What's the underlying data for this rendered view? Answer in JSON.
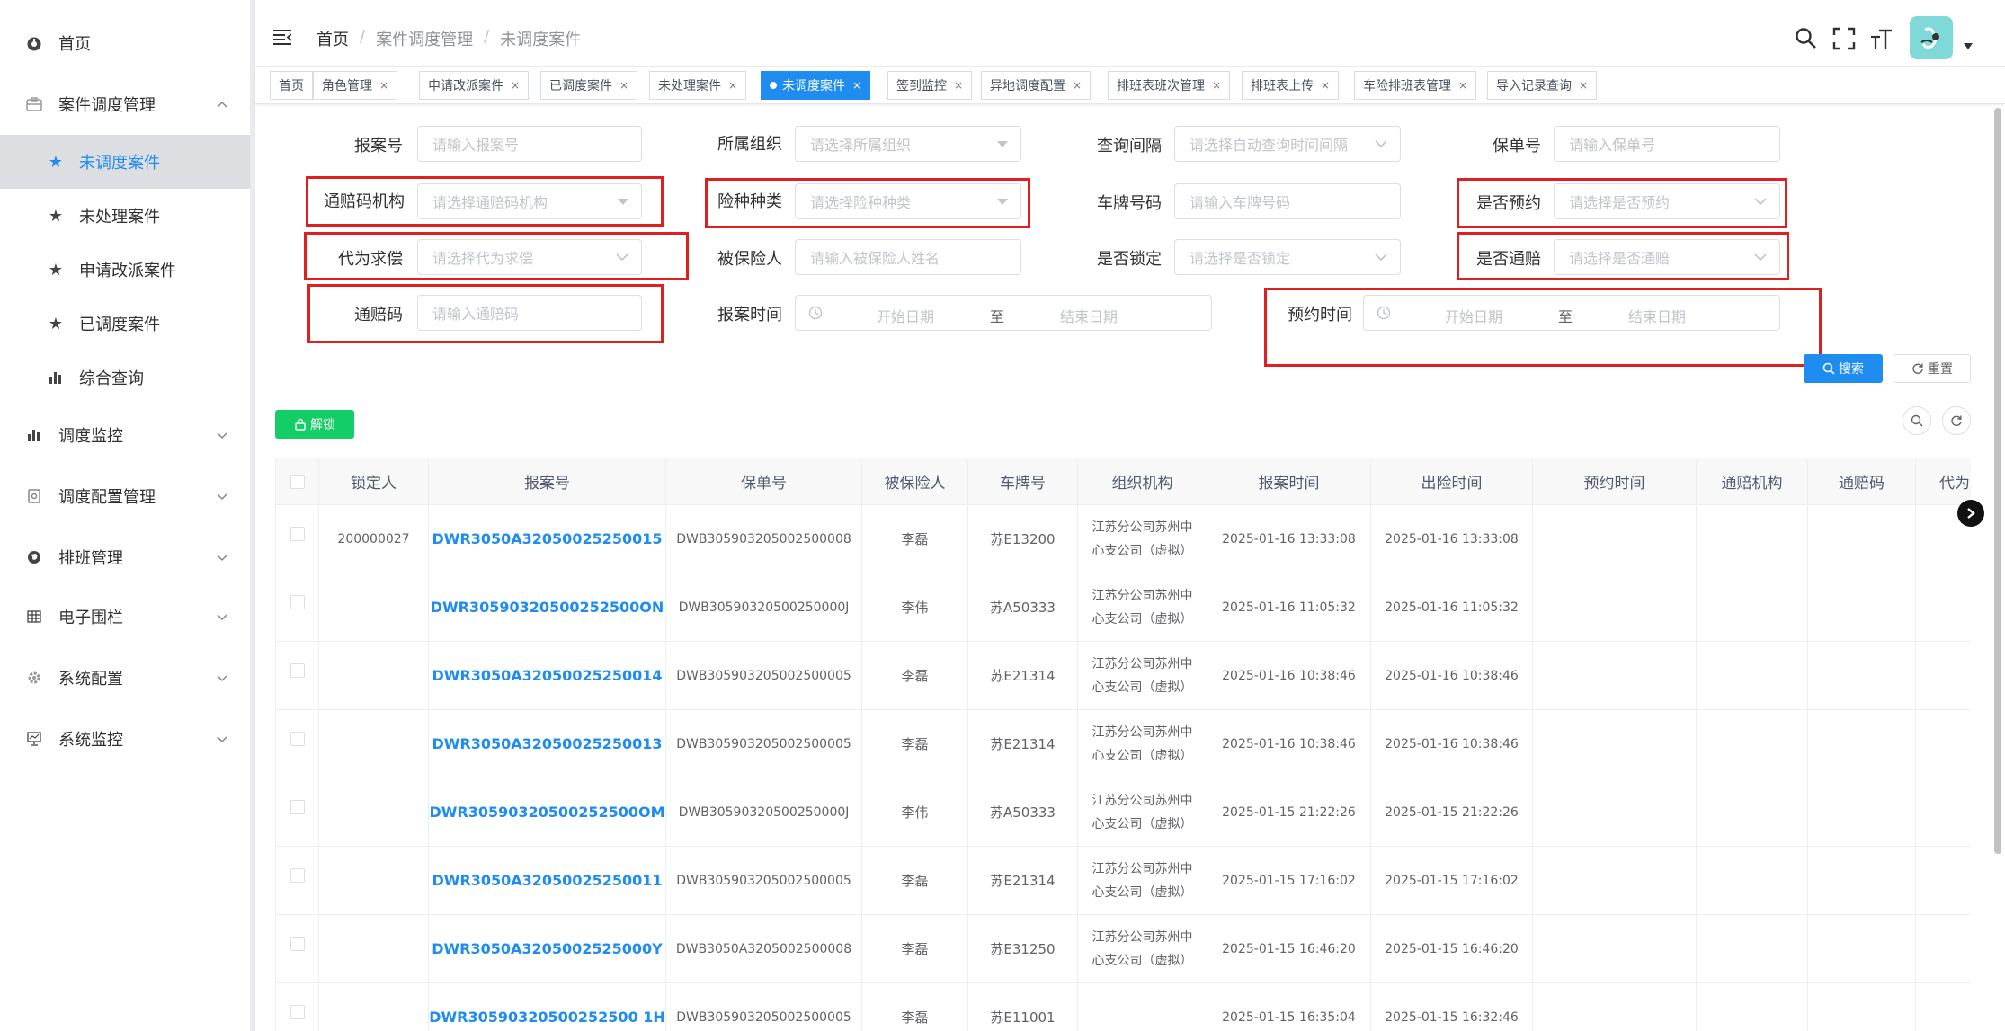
{
  "sidebar": {
    "items": [
      {
        "label": "首页",
        "icon": "dashboard-icon"
      },
      {
        "label": "案件调度管理",
        "icon": "case-icon"
      },
      {
        "label": "未调度案件",
        "icon": "star-icon"
      },
      {
        "label": "未处理案件",
        "icon": "star-icon"
      },
      {
        "label": "申请改派案件",
        "icon": "star-icon"
      },
      {
        "label": "已调度案件",
        "icon": "star-icon"
      },
      {
        "label": "综合查询",
        "icon": "bar-chart-icon"
      },
      {
        "label": "调度监控",
        "icon": "bar-chart-icon"
      },
      {
        "label": "调度配置管理",
        "icon": "config-icon"
      },
      {
        "label": "排班管理",
        "icon": "globe-icon"
      },
      {
        "label": "电子围栏",
        "icon": "grid-icon"
      },
      {
        "label": "系统配置",
        "icon": "gear-icon"
      },
      {
        "label": "系统监控",
        "icon": "monitor-icon"
      }
    ]
  },
  "header": {
    "breadcrumb": [
      "首页",
      "案件调度管理",
      "未调度案件"
    ],
    "separator": "/"
  },
  "tags": [
    {
      "label": "首页",
      "closable": false
    },
    {
      "label": "角色管理",
      "closable": true
    },
    {
      "label": "申请改派案件",
      "closable": true
    },
    {
      "label": "已调度案件",
      "closable": true
    },
    {
      "label": "未处理案件",
      "closable": true
    },
    {
      "label": "未调度案件",
      "closable": true,
      "active": true
    },
    {
      "label": "签到监控",
      "closable": true
    },
    {
      "label": "异地调度配置",
      "closable": true
    },
    {
      "label": "排班表班次管理",
      "closable": true
    },
    {
      "label": "排班表上传",
      "closable": true
    },
    {
      "label": "车险排班表管理",
      "closable": true
    },
    {
      "label": "导入记录查询",
      "closable": true
    }
  ],
  "close_glyph": "×",
  "form": {
    "report_no": {
      "label": "报案号",
      "placeholder": "请输入报案号"
    },
    "org": {
      "label": "所属组织",
      "placeholder": "请选择所属组织"
    },
    "interval": {
      "label": "查询间隔",
      "placeholder": "请选择自动查询时间间隔"
    },
    "policy_no": {
      "label": "保单号",
      "placeholder": "请输入保单号"
    },
    "tongpei_org": {
      "label": "通赔码机构",
      "placeholder": "请选择通赔码机构"
    },
    "insurance_type": {
      "label": "险种种类",
      "placeholder": "请选择险种种类"
    },
    "plate_no": {
      "label": "车牌号码",
      "placeholder": "请输入车牌号码"
    },
    "reserved": {
      "label": "是否预约",
      "placeholder": "请选择是否预约"
    },
    "subrogation": {
      "label": "代为求偿",
      "placeholder": "请选择代为求偿"
    },
    "insured": {
      "label": "被保险人",
      "placeholder": "请输入被保险人姓名"
    },
    "locked": {
      "label": "是否锁定",
      "placeholder": "请选择是否锁定"
    },
    "tongpei": {
      "label": "是否通赔",
      "placeholder": "请选择是否通赔"
    },
    "tongpei_code": {
      "label": "通赔码",
      "placeholder": "请输入通赔码"
    },
    "report_time": {
      "label": "报案时间",
      "start": "开始日期",
      "to": "至",
      "end": "结束日期"
    },
    "reserve_time": {
      "label": "预约时间",
      "start": "开始日期",
      "to": "至",
      "end": "结束日期"
    }
  },
  "buttons": {
    "search": "搜索",
    "reset": "重置",
    "unlock": "解锁"
  },
  "table": {
    "columns": [
      "锁定人",
      "报案号",
      "保单号",
      "被保险人",
      "车牌号",
      "组织机构",
      "报案时间",
      "出险时间",
      "预约时间",
      "通赔机构",
      "通赔码",
      "代为求"
    ],
    "rows": [
      {
        "locker": "200000027",
        "report_no": "DWR3050A32050025250015",
        "policy_no": "DWB305903205002500008",
        "insured": "李磊",
        "plate": "苏E13200",
        "org": "江苏分公司苏州中心支公司（虚拟）",
        "report_time": "2025-01-16 13:33:08",
        "accident_time": "2025-01-16 13:33:08"
      },
      {
        "locker": "",
        "report_no": "DWR30590320500252500ON",
        "policy_no": "DWB30590320500250000J",
        "insured": "李伟",
        "plate": "苏A50333",
        "org": "江苏分公司苏州中心支公司（虚拟）",
        "report_time": "2025-01-16 11:05:32",
        "accident_time": "2025-01-16 11:05:32"
      },
      {
        "locker": "",
        "report_no": "DWR3050A32050025250014",
        "policy_no": "DWB305903205002500005",
        "insured": "李磊",
        "plate": "苏E21314",
        "org": "江苏分公司苏州中心支公司（虚拟）",
        "report_time": "2025-01-16 10:38:46",
        "accident_time": "2025-01-16 10:38:46"
      },
      {
        "locker": "",
        "report_no": "DWR3050A32050025250013",
        "policy_no": "DWB305903205002500005",
        "insured": "李磊",
        "plate": "苏E21314",
        "org": "江苏分公司苏州中心支公司（虚拟）",
        "report_time": "2025-01-16 10:38:46",
        "accident_time": "2025-01-16 10:38:46"
      },
      {
        "locker": "",
        "report_no": "DWR30590320500252500OM",
        "policy_no": "DWB30590320500250000J",
        "insured": "李伟",
        "plate": "苏A50333",
        "org": "江苏分公司苏州中心支公司（虚拟）",
        "report_time": "2025-01-15 21:22:26",
        "accident_time": "2025-01-15 21:22:26"
      },
      {
        "locker": "",
        "report_no": "DWR3050A32050025250011",
        "policy_no": "DWB305903205002500005",
        "insured": "李磊",
        "plate": "苏E21314",
        "org": "江苏分公司苏州中心支公司（虚拟）",
        "report_time": "2025-01-15 17:16:02",
        "accident_time": "2025-01-15 17:16:02"
      },
      {
        "locker": "",
        "report_no": "DWR3050A3205002525000Y",
        "policy_no": "DWB3050A3205002500008",
        "insured": "李磊",
        "plate": "苏E31250",
        "org": "江苏分公司苏州中心支公司（虚拟）",
        "report_time": "2025-01-15 16:46:20",
        "accident_time": "2025-01-15 16:46:20"
      },
      {
        "locker": "",
        "report_no": "DWR30590320500252500 1H",
        "policy_no": "DWB305903205002500005",
        "insured": "李磊",
        "plate": "苏E11001",
        "org": "",
        "report_time": "2025-01-15 16:35:04",
        "accident_time": "2025-01-15 16:32:46"
      }
    ]
  }
}
